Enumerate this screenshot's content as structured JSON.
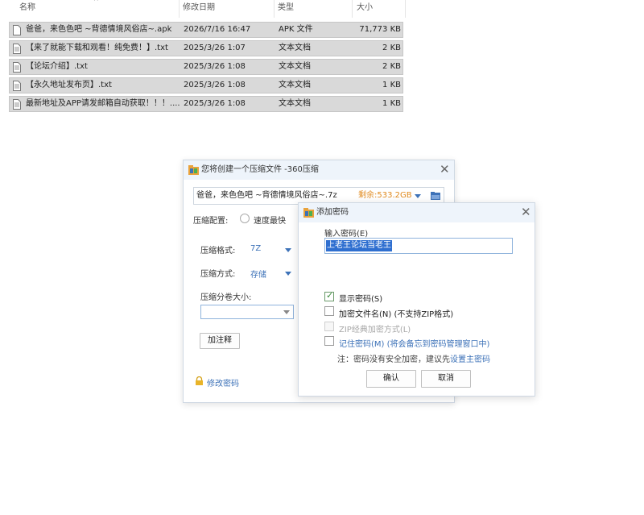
{
  "file_list": {
    "columns": {
      "name": "名称",
      "date": "修改日期",
      "type": "类型",
      "size": "大小"
    },
    "rows": [
      {
        "name": "爸爸，来色色吧 ~背德情境风俗店~.apk",
        "date": "2026/7/16 16:47",
        "type": "APK 文件",
        "size": "71,773 KB",
        "icon": "apk-file-icon"
      },
      {
        "name": "【来了就能下载和观看！纯免费！】.txt",
        "date": "2025/3/26 1:07",
        "type": "文本文档",
        "size": "2 KB",
        "icon": "text-file-icon"
      },
      {
        "name": "【论坛介绍】.txt",
        "date": "2025/3/26 1:08",
        "type": "文本文档",
        "size": "2 KB",
        "icon": "text-file-icon"
      },
      {
        "name": "【永久地址发布页】.txt",
        "date": "2025/3/26 1:08",
        "type": "文本文档",
        "size": "1 KB",
        "icon": "text-file-icon"
      },
      {
        "name": "最新地址及APP请发邮箱自动获取！！！....",
        "date": "2025/3/26 1:08",
        "type": "文本文档",
        "size": "1 KB",
        "icon": "text-file-icon"
      }
    ]
  },
  "zip_dialog": {
    "title": "您将创建一个压缩文件 -360压缩",
    "filename": "爸爸，来色色吧 ~背德情境风俗店~.7z",
    "free_space": "剩余:533.2GB",
    "config_label": "压缩配置:",
    "speed_option": "速度最快",
    "format_label": "压缩格式:",
    "format_value": "7Z",
    "method_label": "压缩方式:",
    "method_value": "存储",
    "volume_label": "压缩分卷大小:",
    "comment_button": "加注释",
    "change_password_link": "修改密码"
  },
  "password_dialog": {
    "title": "添加密码",
    "input_label": "输入密码(E)",
    "password_value": "上老王论坛当老王",
    "show_password": "显示密码(S)",
    "encrypt_filenames": "加密文件名(N) (不支持ZIP格式)",
    "zip_classic": "ZIP经典加密方式(L)",
    "remember_password": "记住密码(M) (将会备忘到密码管理窗口中)",
    "note_prefix": "注：密码没有安全加密，建议先",
    "note_link": "设置主密码",
    "ok_button": "确认",
    "cancel_button": "取消"
  },
  "colors": {
    "accent": "#3d72b8",
    "free_space": "#e08a1e",
    "selection": "#2f6fd0"
  }
}
